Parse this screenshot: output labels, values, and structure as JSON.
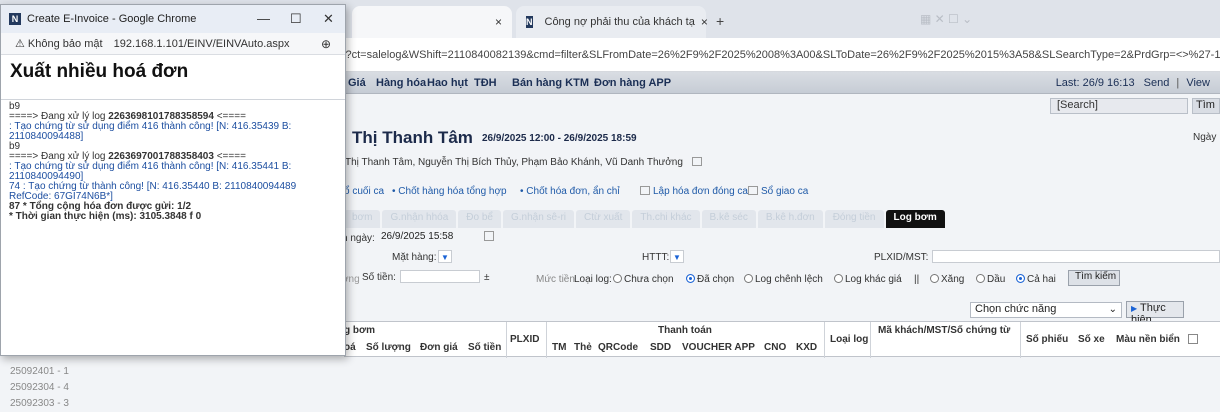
{
  "browser": {
    "tabs": [
      {
        "label": "",
        "close": "×"
      },
      {
        "label": "Công nợ phải thu của khách tạ",
        "close": "×"
      }
    ],
    "new_tab": "+",
    "url_fragment": "x?ct=salelog&WShift=2110840082139&cmd=filter&SLFromDate=26%2F9%2F2025%2008%3A00&SLToDate=26%2F9%2F2025%2015%3A58&SLSearchType=2&PrdGrp=<>%27-1%27"
  },
  "nav": {
    "items": [
      "Giá",
      "Hàng hóa",
      "Hao hụt",
      "TĐH",
      "Bán hàng KTM",
      "Đơn hàng APP"
    ],
    "last_update": "Last: 26/9 16:13",
    "send": "Send",
    "view": "View",
    "separator": "|"
  },
  "search": {
    "value": "[Search]",
    "button": "Tìm"
  },
  "page": {
    "title": "Thị Thanh Tâm",
    "dates": "26/9/2025 12:00 - 26/9/2025 18:59",
    "right_label": "Ngày",
    "staff": "Thị Thanh Tâm, Nguyễn Thị Bích Thủy, Phạm Bảo Khánh, Vũ Danh Thưởng"
  },
  "links": [
    "ổ cuối ca",
    "• Chốt hàng hóa tổng hợp",
    "• Chốt hóa đơn, ẩn chỉ",
    "Lập hóa đơn đóng ca",
    "Sổ giao ca"
  ],
  "function_tabs": [
    "bơm",
    "G.nhận hhóa",
    "Đo bể",
    "G.nhận sê-ri",
    "Ctừ xuất",
    "Th.chi khác",
    "B.kê séc",
    "B.kê h.đơn",
    "Đóng tiền",
    "Log bơm"
  ],
  "filters": {
    "date_label": "n ngày:",
    "date_value": "26/9/2025 15:58",
    "mat_hang": "Mặt hàng:",
    "httt": "HTTT:",
    "plxid": "PLXID/MST:",
    "luong": "ợng",
    "so_tien": "Số tiền:",
    "pm": "±",
    "muc_tien": "Mức tiền",
    "loai_log": "Loại log:",
    "radios1": [
      "Chưa chọn",
      "Đã chọn",
      "Log chênh lệch",
      "Log khác giá"
    ],
    "sep": "||",
    "radios2": [
      "Xăng",
      "Dầu",
      "Cả hai"
    ],
    "search_button": "Tìm kiếm"
  },
  "actions": {
    "select": "Chọn chức năng",
    "execute": "Thực hiện"
  },
  "grid": {
    "group1": "g bơm",
    "plxid": "PLXID",
    "thanh_toan": "Thanh toán",
    "loai_log": "Loại log",
    "ma_khach": "Mã khách/MST/Số chứng từ",
    "so_phieu": "Số phiếu",
    "so_xe": "Số xe",
    "mau_nen": "Màu nền biển",
    "sub1": [
      "oá",
      "Số lượng",
      "Đơn giá",
      "Số tiền"
    ],
    "sub2": [
      "TM",
      "Thẻ",
      "QRCode",
      "SDD",
      "VOUCHER APP",
      "CNO",
      "KXD"
    ]
  },
  "bottom_list": [
    "25092401 - 1",
    "25092304 - 4",
    "25092303 - 3"
  ],
  "popup": {
    "window_title": "Create E-Invoice - Google Chrome",
    "min": "—",
    "max": "☐",
    "close": "✕",
    "security": "⚠ Không bảo mật",
    "url": "192.168.1.101/EINV/EINVAuto.aspx",
    "heading": "Xuất nhiều hoá đơn",
    "log": [
      {
        "text": "b9",
        "cls": ""
      },
      {
        "text": "====> Đang xử lý log ",
        "bold": "2263698101788358594",
        "tail": " <====",
        "cls": ""
      },
      {
        "text": ": Tạo chứng từ sử dụng điểm 416 thành công! [N: 416.35439 B: 2110840094488]",
        "cls": "blue"
      },
      {
        "text": "b9",
        "cls": ""
      },
      {
        "text": "====> Đang xử lý log ",
        "bold": "2263697001788358403",
        "tail": " <====",
        "cls": ""
      },
      {
        "text": ": Tạo chứng từ sử dụng điểm 416 thành công! [N: 416.35441 B: 2110840094490]",
        "cls": "blue"
      },
      {
        "text": "74 : Tạo chứng từ thành công! [N: 416.35440 B: 2110840094489 RefCode: 67GI74N6B*]",
        "cls": "blue"
      },
      {
        "text": "87 * Tổng cộng hóa đơn được gửi: 1/2",
        "cls": "bold"
      },
      {
        "text": "* Thời gian thực hiện (ms): 3105.3848 f 0",
        "cls": "bold"
      }
    ]
  }
}
